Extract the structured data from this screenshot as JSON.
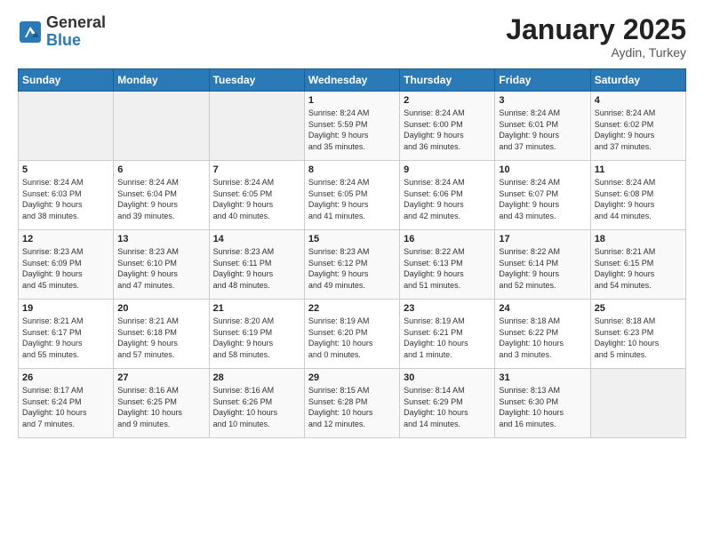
{
  "header": {
    "logo_general": "General",
    "logo_blue": "Blue",
    "month_year": "January 2025",
    "location": "Aydin, Turkey"
  },
  "days_of_week": [
    "Sunday",
    "Monday",
    "Tuesday",
    "Wednesday",
    "Thursday",
    "Friday",
    "Saturday"
  ],
  "weeks": [
    [
      {
        "day": "",
        "info": ""
      },
      {
        "day": "",
        "info": ""
      },
      {
        "day": "",
        "info": ""
      },
      {
        "day": "1",
        "info": "Sunrise: 8:24 AM\nSunset: 5:59 PM\nDaylight: 9 hours\nand 35 minutes."
      },
      {
        "day": "2",
        "info": "Sunrise: 8:24 AM\nSunset: 6:00 PM\nDaylight: 9 hours\nand 36 minutes."
      },
      {
        "day": "3",
        "info": "Sunrise: 8:24 AM\nSunset: 6:01 PM\nDaylight: 9 hours\nand 37 minutes."
      },
      {
        "day": "4",
        "info": "Sunrise: 8:24 AM\nSunset: 6:02 PM\nDaylight: 9 hours\nand 37 minutes."
      }
    ],
    [
      {
        "day": "5",
        "info": "Sunrise: 8:24 AM\nSunset: 6:03 PM\nDaylight: 9 hours\nand 38 minutes."
      },
      {
        "day": "6",
        "info": "Sunrise: 8:24 AM\nSunset: 6:04 PM\nDaylight: 9 hours\nand 39 minutes."
      },
      {
        "day": "7",
        "info": "Sunrise: 8:24 AM\nSunset: 6:05 PM\nDaylight: 9 hours\nand 40 minutes."
      },
      {
        "day": "8",
        "info": "Sunrise: 8:24 AM\nSunset: 6:05 PM\nDaylight: 9 hours\nand 41 minutes."
      },
      {
        "day": "9",
        "info": "Sunrise: 8:24 AM\nSunset: 6:06 PM\nDaylight: 9 hours\nand 42 minutes."
      },
      {
        "day": "10",
        "info": "Sunrise: 8:24 AM\nSunset: 6:07 PM\nDaylight: 9 hours\nand 43 minutes."
      },
      {
        "day": "11",
        "info": "Sunrise: 8:24 AM\nSunset: 6:08 PM\nDaylight: 9 hours\nand 44 minutes."
      }
    ],
    [
      {
        "day": "12",
        "info": "Sunrise: 8:23 AM\nSunset: 6:09 PM\nDaylight: 9 hours\nand 45 minutes."
      },
      {
        "day": "13",
        "info": "Sunrise: 8:23 AM\nSunset: 6:10 PM\nDaylight: 9 hours\nand 47 minutes."
      },
      {
        "day": "14",
        "info": "Sunrise: 8:23 AM\nSunset: 6:11 PM\nDaylight: 9 hours\nand 48 minutes."
      },
      {
        "day": "15",
        "info": "Sunrise: 8:23 AM\nSunset: 6:12 PM\nDaylight: 9 hours\nand 49 minutes."
      },
      {
        "day": "16",
        "info": "Sunrise: 8:22 AM\nSunset: 6:13 PM\nDaylight: 9 hours\nand 51 minutes."
      },
      {
        "day": "17",
        "info": "Sunrise: 8:22 AM\nSunset: 6:14 PM\nDaylight: 9 hours\nand 52 minutes."
      },
      {
        "day": "18",
        "info": "Sunrise: 8:21 AM\nSunset: 6:15 PM\nDaylight: 9 hours\nand 54 minutes."
      }
    ],
    [
      {
        "day": "19",
        "info": "Sunrise: 8:21 AM\nSunset: 6:17 PM\nDaylight: 9 hours\nand 55 minutes."
      },
      {
        "day": "20",
        "info": "Sunrise: 8:21 AM\nSunset: 6:18 PM\nDaylight: 9 hours\nand 57 minutes."
      },
      {
        "day": "21",
        "info": "Sunrise: 8:20 AM\nSunset: 6:19 PM\nDaylight: 9 hours\nand 58 minutes."
      },
      {
        "day": "22",
        "info": "Sunrise: 8:19 AM\nSunset: 6:20 PM\nDaylight: 10 hours\nand 0 minutes."
      },
      {
        "day": "23",
        "info": "Sunrise: 8:19 AM\nSunset: 6:21 PM\nDaylight: 10 hours\nand 1 minute."
      },
      {
        "day": "24",
        "info": "Sunrise: 8:18 AM\nSunset: 6:22 PM\nDaylight: 10 hours\nand 3 minutes."
      },
      {
        "day": "25",
        "info": "Sunrise: 8:18 AM\nSunset: 6:23 PM\nDaylight: 10 hours\nand 5 minutes."
      }
    ],
    [
      {
        "day": "26",
        "info": "Sunrise: 8:17 AM\nSunset: 6:24 PM\nDaylight: 10 hours\nand 7 minutes."
      },
      {
        "day": "27",
        "info": "Sunrise: 8:16 AM\nSunset: 6:25 PM\nDaylight: 10 hours\nand 9 minutes."
      },
      {
        "day": "28",
        "info": "Sunrise: 8:16 AM\nSunset: 6:26 PM\nDaylight: 10 hours\nand 10 minutes."
      },
      {
        "day": "29",
        "info": "Sunrise: 8:15 AM\nSunset: 6:28 PM\nDaylight: 10 hours\nand 12 minutes."
      },
      {
        "day": "30",
        "info": "Sunrise: 8:14 AM\nSunset: 6:29 PM\nDaylight: 10 hours\nand 14 minutes."
      },
      {
        "day": "31",
        "info": "Sunrise: 8:13 AM\nSunset: 6:30 PM\nDaylight: 10 hours\nand 16 minutes."
      },
      {
        "day": "",
        "info": ""
      }
    ]
  ]
}
